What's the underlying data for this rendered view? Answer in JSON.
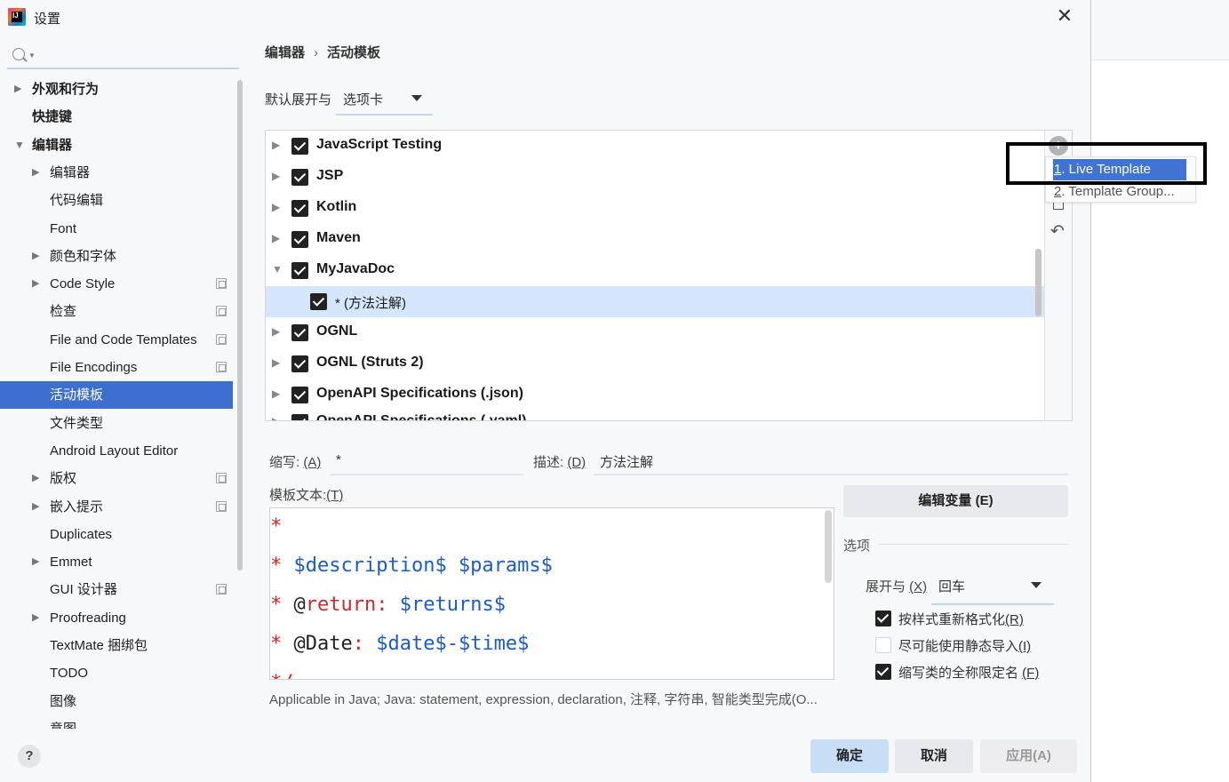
{
  "window": {
    "title": "设置"
  },
  "nav": {
    "items": [
      {
        "label": "外观和行为",
        "arrow": "▶",
        "bold": true
      },
      {
        "label": "快捷键",
        "arrow": "",
        "bold": true
      },
      {
        "label": "编辑器",
        "arrow": "▼",
        "bold": true
      },
      {
        "label": "编辑器",
        "arrow": "▶",
        "bold": false
      },
      {
        "label": "代码编辑",
        "arrow": "",
        "bold": false
      },
      {
        "label": "Font",
        "arrow": "",
        "bold": false
      },
      {
        "label": "颜色和字体",
        "arrow": "▶",
        "bold": false
      },
      {
        "label": "Code Style",
        "arrow": "▶",
        "bold": false,
        "copy_icon": true
      },
      {
        "label": "检查",
        "arrow": "",
        "bold": false,
        "copy_icon": true
      },
      {
        "label": "File and Code Templates",
        "arrow": "",
        "bold": false,
        "copy_icon": true
      },
      {
        "label": "File Encodings",
        "arrow": "",
        "bold": false,
        "copy_icon": true
      },
      {
        "label": "活动模板",
        "arrow": "",
        "bold": false,
        "selected": true
      },
      {
        "label": "文件类型",
        "arrow": "",
        "bold": false
      },
      {
        "label": "Android Layout Editor",
        "arrow": "",
        "bold": false
      },
      {
        "label": "版权",
        "arrow": "▶",
        "bold": false,
        "copy_icon": true
      },
      {
        "label": "嵌入提示",
        "arrow": "▶",
        "bold": false,
        "copy_icon": true
      },
      {
        "label": "Duplicates",
        "arrow": "",
        "bold": false
      },
      {
        "label": "Emmet",
        "arrow": "▶",
        "bold": false
      },
      {
        "label": "GUI 设计器",
        "arrow": "",
        "bold": false,
        "copy_icon": true
      },
      {
        "label": "Proofreading",
        "arrow": "▶",
        "bold": false
      },
      {
        "label": "TextMate 捆绑包",
        "arrow": "",
        "bold": false
      },
      {
        "label": "TODO",
        "arrow": "",
        "bold": false
      },
      {
        "label": "图像",
        "arrow": "",
        "bold": false
      },
      {
        "label": "意图",
        "arrow": "",
        "bold": false
      }
    ]
  },
  "breadcrumb": {
    "parent": "编辑器",
    "separator": "›",
    "current": "活动模板"
  },
  "expand_by_default": {
    "label": "默认展开与",
    "value": "选项卡"
  },
  "template_tree": {
    "rows": [
      {
        "label": "JavaScript Testing",
        "expanded": false,
        "level": 0
      },
      {
        "label": "JSP",
        "expanded": false,
        "level": 0
      },
      {
        "label": "Kotlin",
        "expanded": false,
        "level": 0
      },
      {
        "label": "Maven",
        "expanded": false,
        "level": 0
      },
      {
        "label": "MyJavaDoc",
        "expanded": true,
        "level": 0
      },
      {
        "label": "* (方法注解)",
        "expanded": false,
        "level": 1,
        "selected": true
      },
      {
        "label": "OGNL",
        "expanded": false,
        "level": 0
      },
      {
        "label": "OGNL (Struts 2)",
        "expanded": false,
        "level": 0
      },
      {
        "label": "OpenAPI Specifications (.json)",
        "expanded": false,
        "level": 0
      },
      {
        "label": "OpenAPI Specifications (.yaml)",
        "expanded": false,
        "level": 0
      }
    ],
    "toolbar": {
      "add": "+",
      "undo": "↶"
    }
  },
  "add_popup": {
    "items": [
      {
        "number": "1",
        "label": ". Live Template"
      },
      {
        "number": "2",
        "label": ". Template Group..."
      }
    ]
  },
  "abbreviation": {
    "label": "缩写: ",
    "mnemonic": "(A)",
    "value": "*"
  },
  "description": {
    "label": "描述: ",
    "mnemonic": "(D)",
    "value": "方法注解"
  },
  "template_text": {
    "label": "模板文本:",
    "mnemonic": "(T)",
    "lines": [
      {
        "star": "*",
        "parts": []
      },
      {
        "star": "*",
        "parts": [
          {
            "t": " ",
            "c": "plain"
          },
          {
            "t": "$description$ $params$",
            "c": "var"
          }
        ]
      },
      {
        "star": "*",
        "parts": [
          {
            "t": " @",
            "c": "plain"
          },
          {
            "t": "return",
            "c": "kw"
          },
          {
            "t": ": ",
            "c": "kw"
          },
          {
            "t": "$returns$",
            "c": "var"
          }
        ]
      },
      {
        "star": "*",
        "parts": [
          {
            "t": " @Date",
            "c": "plain"
          },
          {
            "t": ": ",
            "c": "kw"
          },
          {
            "t": "$date$-$time$",
            "c": "var"
          }
        ]
      },
      {
        "star": "*/",
        "parts": []
      }
    ]
  },
  "applicable": "Applicable in Java; Java: statement, expression, declaration, 注释, 字符串, 智能类型完成(O...",
  "edit_variables_button": "编辑变量 (E)",
  "options": {
    "title": "选项",
    "expand_with": {
      "label": "展开与 ",
      "mnemonic": "(X)",
      "value": "回车"
    },
    "checkboxes": [
      {
        "label": "按样式重新格式化",
        "mnemonic": "(R)",
        "checked": true
      },
      {
        "label": "尽可能使用静态导入",
        "mnemonic": "(I)",
        "checked": false
      },
      {
        "label": "缩写类的全称限定名 ",
        "mnemonic": "(F)",
        "checked": true
      }
    ]
  },
  "buttons": {
    "ok": "确定",
    "cancel": "取消",
    "apply": "应用(A)"
  },
  "help": "?"
}
